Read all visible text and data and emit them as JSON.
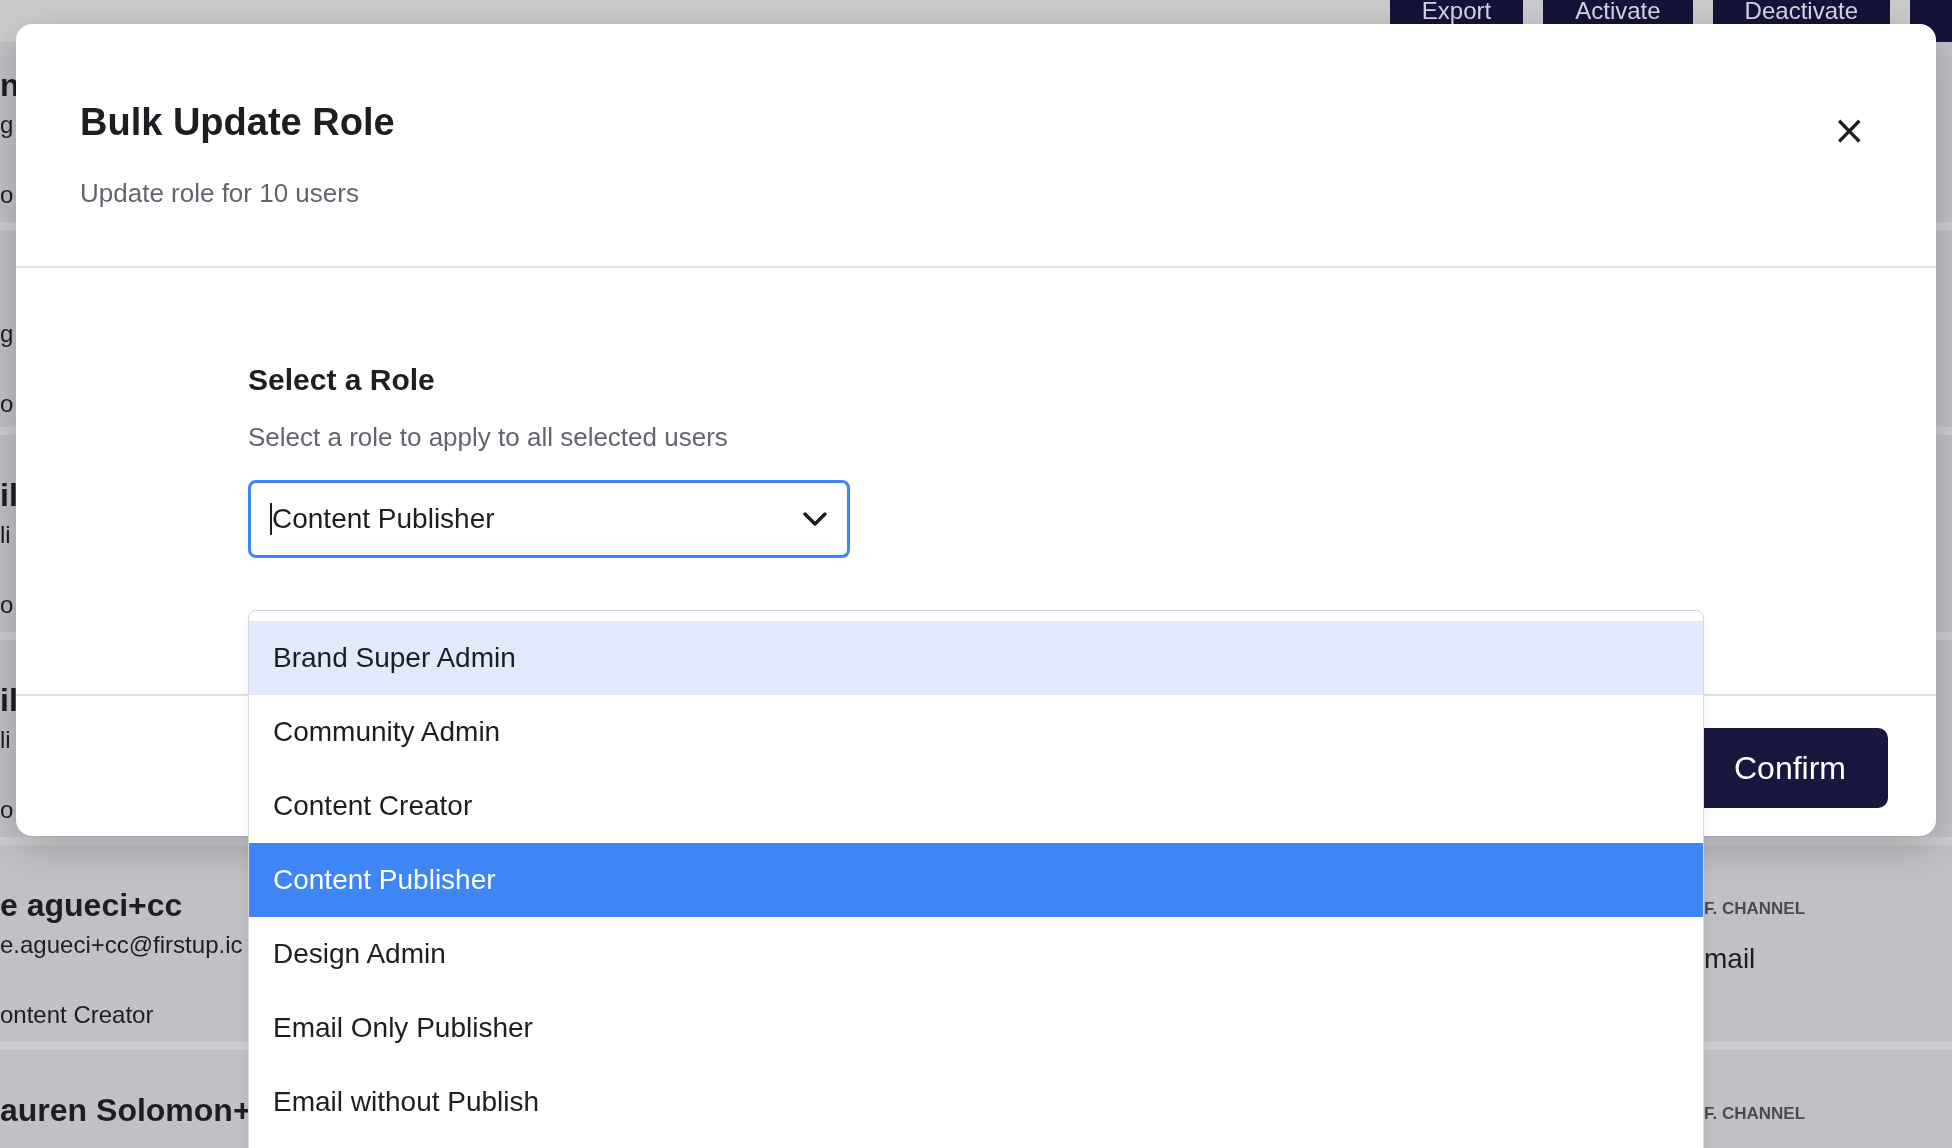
{
  "background": {
    "toolbar_buttons": [
      "Export",
      "Activate",
      "Deactivate"
    ],
    "rows": [
      {
        "name": "n",
        "email": "g",
        "role": "o"
      },
      {
        "email": "g",
        "role": "o"
      },
      {
        "name": "il",
        "email": "li",
        "role": "o"
      },
      {
        "name": "il",
        "email": "li",
        "role": "o"
      },
      {
        "name": "e agueci+cc",
        "email": "e.agueci+cc@firstup.ic",
        "role": "ontent Creator",
        "channel_label": "F. CHANNEL",
        "channel_value": "mail"
      },
      {
        "name": "auren Solomon+",
        "channel_label": "F. CHANNEL"
      }
    ]
  },
  "modal": {
    "title": "Bulk Update Role",
    "subtitle": "Update role for 10 users",
    "close": "×",
    "section_title": "Select a Role",
    "section_hint": "Select a role to apply to all selected users",
    "select": {
      "value": "Content Publisher",
      "focused": true
    },
    "confirm": "Confirm"
  },
  "dropdown": {
    "options": [
      {
        "label": "Brand Super Admin",
        "highlighted": true,
        "selected": false
      },
      {
        "label": "Community Admin",
        "highlighted": false,
        "selected": false
      },
      {
        "label": "Content Creator",
        "highlighted": false,
        "selected": false
      },
      {
        "label": "Content Publisher",
        "highlighted": false,
        "selected": true
      },
      {
        "label": "Design Admin",
        "highlighted": false,
        "selected": false
      },
      {
        "label": "Email Only Publisher",
        "highlighted": false,
        "selected": false
      },
      {
        "label": "Email without Publish",
        "highlighted": false,
        "selected": false
      }
    ]
  }
}
